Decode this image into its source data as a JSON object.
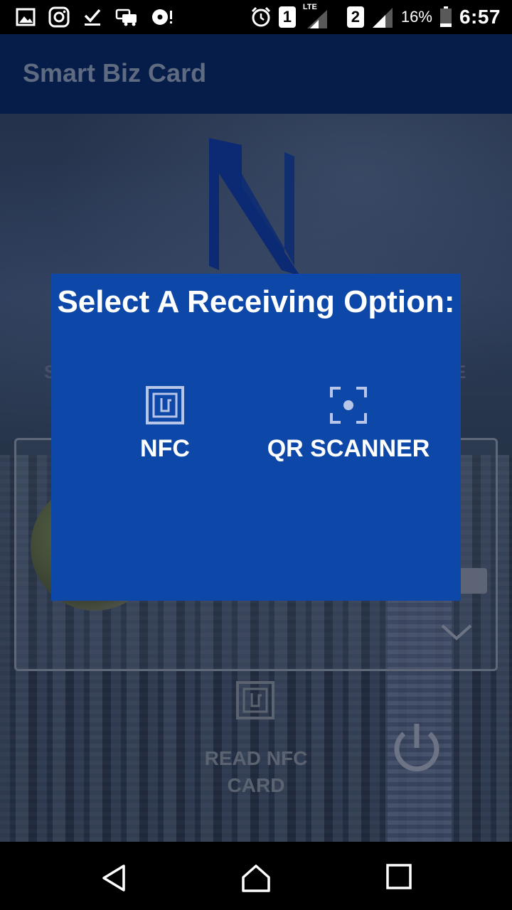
{
  "status_bar": {
    "icons": [
      "gallery-icon",
      "instagram-icon",
      "download-done-icon",
      "car-icon",
      "record-icon",
      "alarm-icon",
      "signal-icon",
      "signal-icon"
    ],
    "sim1": "1",
    "sim2": "2",
    "network": "LTE",
    "battery": "16%",
    "time": "6:57"
  },
  "app_bar": {
    "title": "Smart Biz Card"
  },
  "background": {
    "read_nfc_label": "READ NFC CARD",
    "side_text_left": "S",
    "side_text_right": "E"
  },
  "dialog": {
    "title": "Select A Receiving Option:",
    "options": [
      {
        "label": "NFC",
        "icon": "nfc-icon"
      },
      {
        "label": "QR SCANNER",
        "icon": "qr-scanner-icon"
      }
    ]
  },
  "nav_bar": {
    "buttons": [
      "back",
      "home",
      "recents"
    ]
  },
  "colors": {
    "dialog_bg": "#0d47a8",
    "app_bar_bg": "#061c49",
    "icon_light": "#b7c6e8"
  }
}
